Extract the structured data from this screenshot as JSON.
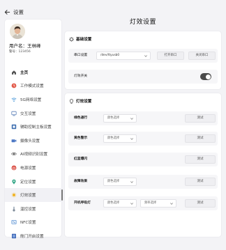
{
  "header": {
    "back_label": "设置"
  },
  "user": {
    "name": "用户名：王林峰",
    "id": "警号：123456"
  },
  "sidebar": {
    "items": [
      {
        "label": "主页",
        "icon": "home-icon"
      },
      {
        "label": "工作模式设置",
        "icon": "work-mode-icon"
      },
      {
        "label": "5G网络设置",
        "icon": "wifi-icon"
      },
      {
        "label": "交互设置",
        "icon": "interaction-icon"
      },
      {
        "label": "辅助控制主板设置",
        "icon": "board-icon"
      },
      {
        "label": "摄像头设置",
        "icon": "camera-icon"
      },
      {
        "label": "AI视频识别设置",
        "icon": "ai-icon"
      },
      {
        "label": "电源设置",
        "icon": "power-icon"
      },
      {
        "label": "定位设置",
        "icon": "location-icon"
      },
      {
        "label": "灯效设置",
        "icon": "light-icon"
      },
      {
        "label": "温控设置",
        "icon": "thermometer-icon"
      },
      {
        "label": "NFC设置",
        "icon": "nfc-icon"
      },
      {
        "label": "舱门开启设置",
        "icon": "hatch-icon"
      }
    ]
  },
  "page": {
    "title": "灯效设置"
  },
  "basic": {
    "title": "基础设置",
    "serial_label": "串口设置",
    "serial_value": "/dev/ttyusb0",
    "open_btn": "打开串口",
    "close_btn": "关闭串口",
    "switch_label": "灯效开关",
    "switch_on": true
  },
  "lights": {
    "title": "灯效设置",
    "select_placeholder": "颜色选择",
    "freq_placeholder": "频率选择",
    "test_label": "测试",
    "rows": [
      {
        "label": "绿色通行"
      },
      {
        "label": "黄色警示"
      },
      {
        "label": "红蓝爆闪"
      },
      {
        "label": "故障效果"
      },
      {
        "label": "开机呼吸灯"
      }
    ]
  },
  "colors": {
    "accent": "#4a4a4a",
    "background": "#f3f3f6"
  }
}
